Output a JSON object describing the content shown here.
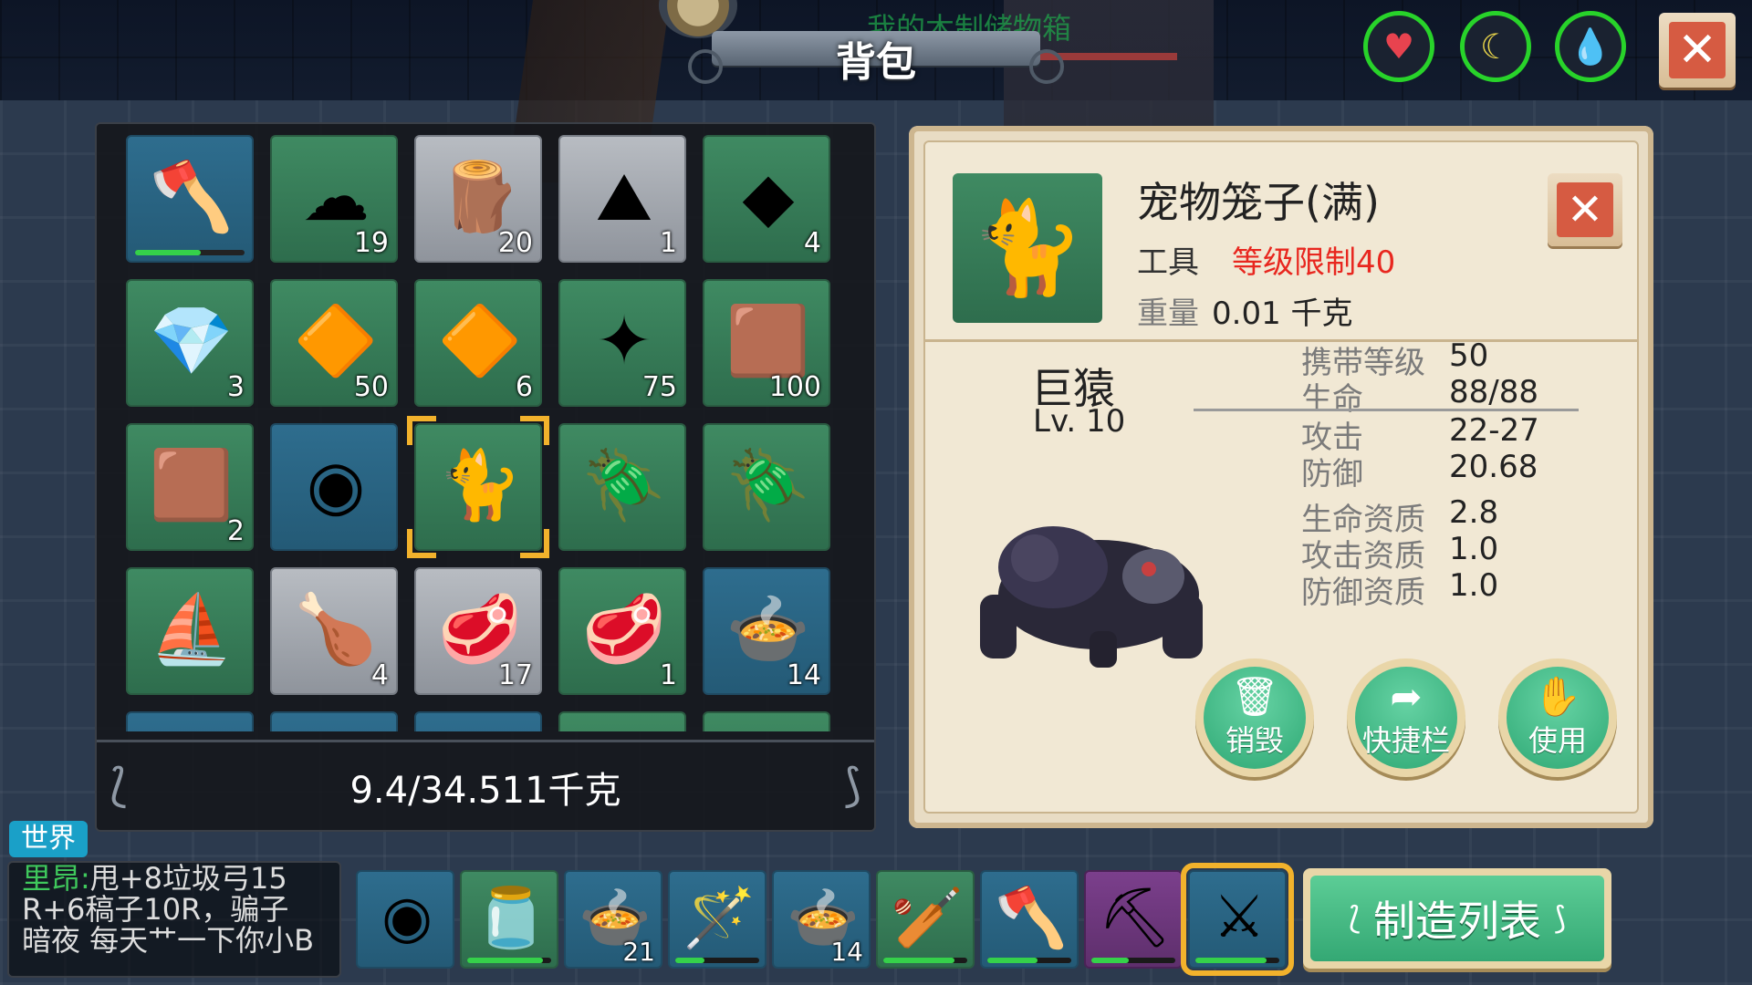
{
  "window": {
    "title": "背包",
    "ghost_title": "我的木制储物箱",
    "close_icon": "close-icon"
  },
  "stats_bar": [
    {
      "name": "health",
      "icon": "heart-icon",
      "color": "#e8434f"
    },
    {
      "name": "hunger",
      "icon": "banana-icon",
      "color": "#e8d44a"
    },
    {
      "name": "thirst",
      "icon": "water-drop-icon",
      "color": "#2ab6e8"
    }
  ],
  "inventory": {
    "weight": "9.4/34.511千克",
    "slots": [
      {
        "item": "battle-axe",
        "glyph": "🪓",
        "count": "",
        "durability": 0.6,
        "style": "blue"
      },
      {
        "item": "cotton",
        "glyph": "☁",
        "count": "19",
        "style": "green"
      },
      {
        "item": "wood-log",
        "glyph": "🪵",
        "count": "20",
        "style": "gray"
      },
      {
        "item": "sand-pile",
        "glyph": "⛰",
        "count": "1",
        "style": "gray"
      },
      {
        "item": "coal",
        "glyph": "◆",
        "count": "4",
        "style": "green"
      },
      {
        "item": "silver-crystal",
        "glyph": "💎",
        "count": "3",
        "style": "green"
      },
      {
        "item": "gold-crystal",
        "glyph": "🔶",
        "count": "50",
        "style": "green"
      },
      {
        "item": "amber-crystal",
        "glyph": "🔶",
        "count": "6",
        "style": "green"
      },
      {
        "item": "green-orb",
        "glyph": "✦",
        "count": "75",
        "style": "green"
      },
      {
        "item": "leather",
        "glyph": "🟫",
        "count": "100",
        "style": "green"
      },
      {
        "item": "hide",
        "glyph": "🟫",
        "count": "2",
        "style": "green"
      },
      {
        "item": "stone-disc",
        "glyph": "◉",
        "count": "",
        "style": "blue"
      },
      {
        "item": "pet-cage",
        "glyph": "🐈",
        "count": "",
        "style": "green",
        "selected": true
      },
      {
        "item": "blue-beetle",
        "glyph": "🪲",
        "count": "",
        "style": "green"
      },
      {
        "item": "blue-beetle-2",
        "glyph": "🪲",
        "count": "",
        "style": "green"
      },
      {
        "item": "wooden-boat",
        "glyph": "⛵",
        "count": "",
        "style": "green"
      },
      {
        "item": "drumstick",
        "glyph": "🍗",
        "count": "4",
        "style": "gray"
      },
      {
        "item": "raw-meat",
        "glyph": "🥩",
        "count": "17",
        "style": "gray"
      },
      {
        "item": "raw-meat-2",
        "glyph": "🥩",
        "count": "1",
        "style": "green"
      },
      {
        "item": "soup-bowl",
        "glyph": "🍲",
        "count": "14",
        "style": "blue"
      },
      {
        "item": "stew-bowl",
        "glyph": "🍲",
        "count": "",
        "style": "blue"
      },
      {
        "item": "curry-bowl",
        "glyph": "🍛",
        "count": "",
        "style": "blue"
      },
      {
        "item": "stew-bowl-2",
        "glyph": "🍲",
        "count": "",
        "style": "blue"
      },
      {
        "item": "blueberries",
        "glyph": "🫐",
        "count": "",
        "style": "green"
      },
      {
        "item": "salt-pile",
        "glyph": "⛰",
        "count": "",
        "style": "green"
      }
    ]
  },
  "detail": {
    "item_name": "宠物笼子(满)",
    "item_type": "工具",
    "level_limit": "等级限制40",
    "weight_label": "重量",
    "weight_value": "0.01 千克",
    "icon": "pet-cage-icon",
    "pet_name": "巨猿",
    "pet_level": "Lv. 10",
    "stats": [
      {
        "label": "携带等级",
        "value": "50"
      },
      {
        "label": "生命",
        "value": "88/88"
      },
      {
        "label": "攻击",
        "value": "22-27"
      },
      {
        "label": "防御",
        "value": "20.68"
      }
    ],
    "aptitudes": [
      {
        "label": "生命资质",
        "value": "2.8"
      },
      {
        "label": "攻击资质",
        "value": "1.0"
      },
      {
        "label": "防御资质",
        "value": "1.0"
      }
    ],
    "buttons": [
      {
        "name": "destroy",
        "label": "销毁",
        "icon": "trash-icon",
        "glyph": "🗑"
      },
      {
        "name": "hotbar",
        "label": "快捷栏",
        "icon": "arrow-back-icon",
        "glyph": "➦"
      },
      {
        "name": "use",
        "label": "使用",
        "icon": "hand-icon",
        "glyph": "✋"
      }
    ]
  },
  "chat": {
    "tab_label": "世界",
    "lines": [
      {
        "user": "里昂",
        "sep": ":",
        "text": "甩+8垃圾弓15"
      },
      {
        "user": "",
        "sep": "",
        "text": "R+6稿子10R，骗子"
      },
      {
        "user": "",
        "sep": "",
        "text": "暗夜 每天艹一下你小B"
      }
    ]
  },
  "hotbar": [
    {
      "item": "stone-disc",
      "glyph": "◉",
      "count": "",
      "style": "blue"
    },
    {
      "item": "water-gourd",
      "glyph": "🫙",
      "count": "",
      "durability": 0.9,
      "style": "green"
    },
    {
      "item": "soup-bowl",
      "glyph": "🍲",
      "count": "21",
      "style": "blue"
    },
    {
      "item": "magic-staff",
      "glyph": "🪄",
      "count": "",
      "durability": 0.35,
      "style": "blue"
    },
    {
      "item": "soup-bowl-2",
      "glyph": "🍲",
      "count": "14",
      "style": "blue"
    },
    {
      "item": "wooden-club",
      "glyph": "🏏",
      "count": "",
      "durability": 0.85,
      "style": "green"
    },
    {
      "item": "battle-axe",
      "glyph": "🪓",
      "count": "",
      "durability": 0.6,
      "style": "blue"
    },
    {
      "item": "pickaxe",
      "glyph": "⛏",
      "count": "",
      "durability": 0.45,
      "style": "purple"
    },
    {
      "item": "scimitar",
      "glyph": "⚔",
      "count": "",
      "durability": 0.85,
      "style": "blue",
      "selected": true
    }
  ],
  "craft": {
    "label": "制造列表"
  },
  "colors": {
    "accent_green": "#3fb87f",
    "danger": "#e8271f",
    "selection": "#f2b22c"
  }
}
